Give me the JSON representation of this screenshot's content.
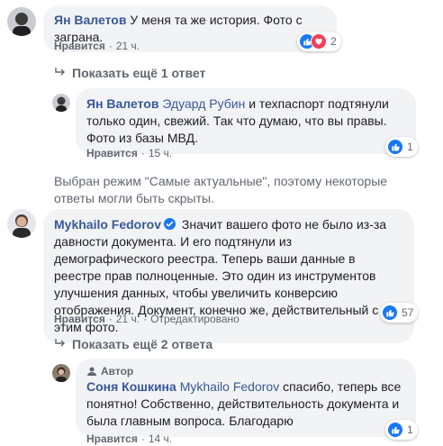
{
  "comments": [
    {
      "author": "Ян Валетов",
      "text": "У меня та же история. Фото с заграна.",
      "like_label": "Нравится",
      "time": "21 ч.",
      "reaction_count": "2"
    },
    {
      "author": "Ян Валетов",
      "mention": "Эдуард Рубин",
      "text": " и техпаспорт подтянули только один, свежий. Так что думаю, что вы правы. Фото из базы МВД.",
      "like_label": "Нравится",
      "time": "15 ч.",
      "reaction_count": "1"
    },
    {
      "author": "Mykhailo Fedorov",
      "text": "Значит вашего фото не было из-за давности документа. И его подтянули из демографического реестра. Теперь ваши данные в реестре прав полноценные. Это один из инструментов улучшения данных, чтобы увеличить конверсию отображения. Документ, конечно же, действительный с этим фото.",
      "like_label": "Нравится",
      "time": "21 ч.",
      "edited_label": "Отредактировано",
      "reaction_count": "57"
    },
    {
      "badge": "Автор",
      "author": "Соня Кошкина",
      "mention": "Mykhailo Fedorov",
      "text": " спасибо, теперь все понятно! Собственно, действительность документа и была главным вопроса. Благодарю",
      "like_label": "Нравится",
      "time": "14 ч.",
      "reaction_count": "1"
    }
  ],
  "more_replies_1": "Показать ещё 1 ответ",
  "more_replies_2": "Показать ещё 2 ответа",
  "notice": "Выбран режим \"Самые актуальные\", поэтому некоторые ответы могли быть скрыты.",
  "separator": "·",
  "colors": {
    "link": "#385898",
    "bubble": "#f2f3f5",
    "like": "#1877f2",
    "love": "#f33e58",
    "meta": "#606770"
  },
  "icons": [
    "like-icon",
    "love-icon",
    "verified-icon",
    "reply-arrow-icon",
    "author-badge-icon"
  ]
}
